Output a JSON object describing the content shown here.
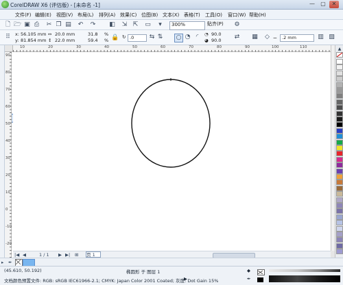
{
  "window": {
    "title": "CorelDRAW X6 (评估版) - [未命名 -1]",
    "min_glyph": "—",
    "max_glyph": "▢",
    "close_glyph": "✕"
  },
  "menu": {
    "items": [
      "文件(F)",
      "编辑(E)",
      "视图(V)",
      "布局(L)",
      "排列(A)",
      "效果(C)",
      "位图(B)",
      "文本(X)",
      "表格(T)",
      "工具(O)",
      "窗口(W)",
      "帮助(H)"
    ]
  },
  "toolbar": {
    "zoom_value": "300%",
    "snap_label": "贴齐(P)"
  },
  "property_bar": {
    "x_label": "x:",
    "x_value": "56.105 mm",
    "y_label": "y:",
    "y_value": "81.854 mm",
    "width_value": "20.0 mm",
    "height_value": "22.0 mm",
    "scale_x": "31.8",
    "scale_y": "59.4",
    "percent": "%",
    "rotation": ".0",
    "angle_start": "90.0",
    "angle_end": "90.0",
    "outline_width": ".2 mm"
  },
  "ruler": {
    "h_ticks": [
      "10",
      "20",
      "30",
      "40",
      "50",
      "60",
      "70",
      "80",
      "90",
      "100",
      "110"
    ],
    "v_ticks": [
      "90",
      "80",
      "70",
      "60",
      "50",
      "40",
      "30",
      "20",
      "10",
      "0",
      "-10",
      "-20"
    ]
  },
  "page_nav": {
    "counter": "1 / 1",
    "page_tab": "页 1"
  },
  "status": {
    "cursor_position": "(45.610, 50.192)",
    "selection": "椭圆形 于 图层 1",
    "color_profile": "文档颜色预置文件: RGB: sRGB IEC61966-2.1; CMYK: Japan Color 2001 Coated; 灰度: Dot Gain 15%"
  },
  "palette_colors": [
    "#ffffff",
    "#f2f2f2",
    "#e0e0e0",
    "#cccccc",
    "#b3b3b3",
    "#999999",
    "#808080",
    "#666666",
    "#4d4d4d",
    "#333333",
    "#1a1a1a",
    "#000000",
    "#2a3fc4",
    "#1f8fd8",
    "#16a84a",
    "#f0e62a",
    "#e8232a",
    "#d62a8e",
    "#8e2a9c",
    "#6a3fb0",
    "#f0a13a",
    "#c87a3a",
    "#9b6b3a",
    "#c9b99a",
    "#b0a8c8",
    "#8f86b8",
    "#7a72a8",
    "#9aa6d0",
    "#b7c3e6",
    "#cfd6ee",
    "#a5a0c8",
    "#8c84b8",
    "#6f6aa4",
    "#9d9ad0"
  ]
}
